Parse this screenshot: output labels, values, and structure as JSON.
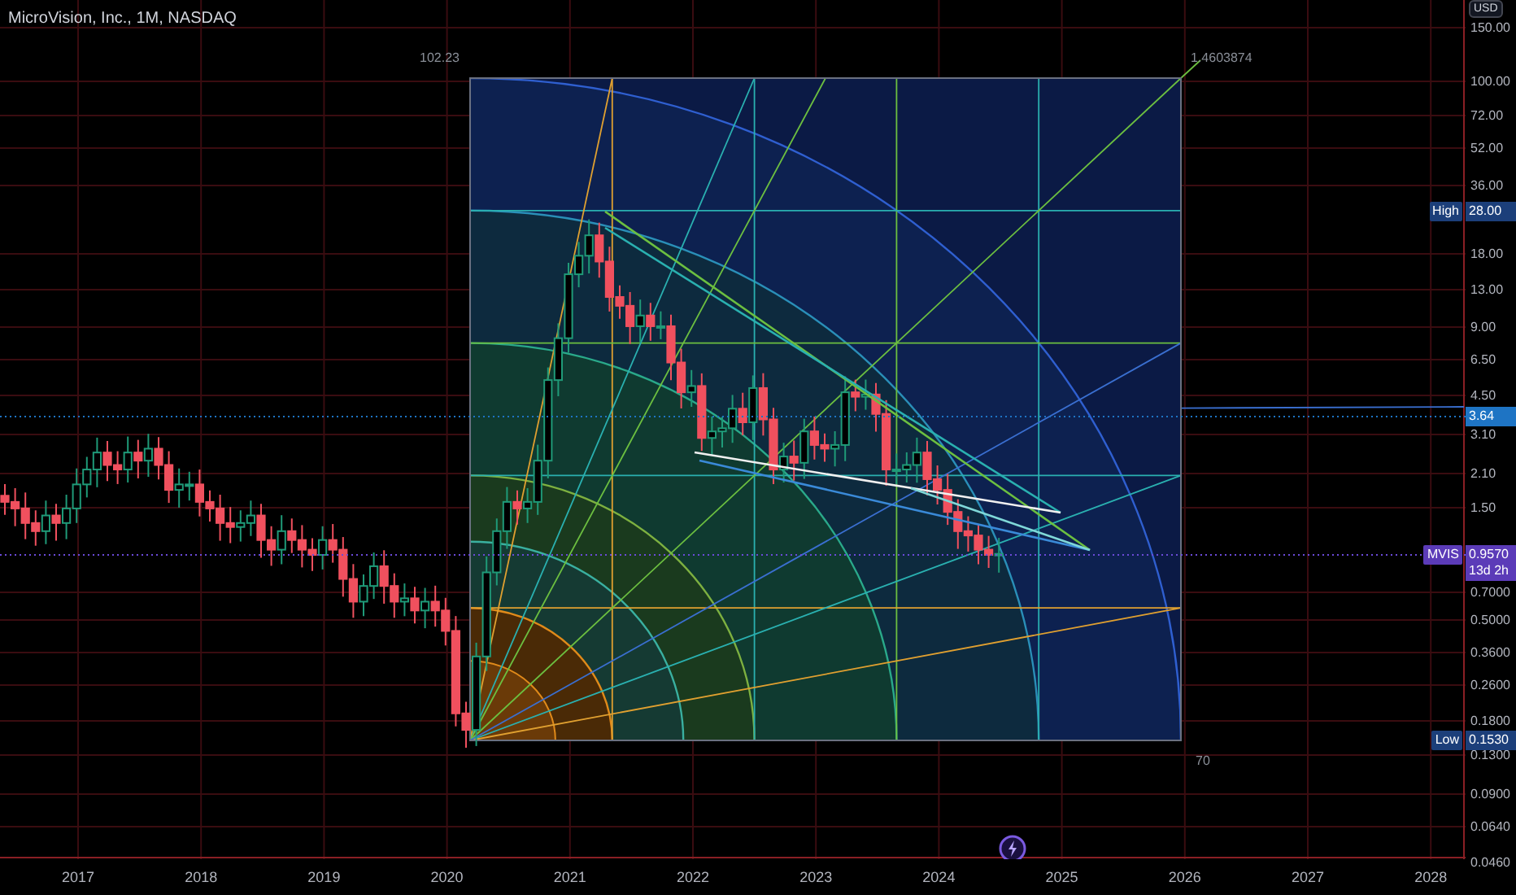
{
  "chart": {
    "title": "MicroVision, Inc., 1M, NASDAQ",
    "box_labels": [
      {
        "kind": "top_left",
        "text": "102.23"
      },
      {
        "kind": "top_right",
        "text": "1.4603874"
      },
      {
        "kind": "bottom_right",
        "text": "70"
      }
    ]
  },
  "price_axis": {
    "currency": "USD",
    "ticks": [
      "150.00",
      "100.00",
      "72.00",
      "52.00",
      "36.00",
      "18.00",
      "13.00",
      "9.00",
      "6.50",
      "4.50",
      "3.10",
      "2.10",
      "1.50",
      "0.7000",
      "0.5000",
      "0.3600",
      "0.2600",
      "0.1800",
      "0.1300",
      "0.0900",
      "0.0640",
      "0.0460"
    ],
    "badges": [
      {
        "kind": "high",
        "label": "High",
        "value": "28.00"
      },
      {
        "kind": "price",
        "value": "3.64"
      },
      {
        "kind": "last",
        "label": "MVIS",
        "value": "0.9570",
        "countdown": "13d 2h"
      },
      {
        "kind": "low",
        "label": "Low",
        "value": "0.1530"
      }
    ]
  },
  "time_axis": {
    "ticks": [
      "2017",
      "2018",
      "2019",
      "2020",
      "2021",
      "2022",
      "2023",
      "2024",
      "2025",
      "2026",
      "2027",
      "2028"
    ]
  }
}
